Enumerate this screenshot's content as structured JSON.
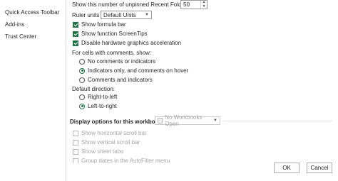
{
  "sidebar": {
    "items": [
      {
        "label": "Quick Access Toolbar"
      },
      {
        "label": "Add-ins"
      },
      {
        "label": "Trust Center"
      }
    ]
  },
  "display": {
    "recent_folders_label": "Show this number of unpinned Recent Folders:",
    "recent_folders_value": "50",
    "ruler_units_label": "Ruler units",
    "ruler_units_value": "Default Units",
    "show_formula_bar": "Show formula bar",
    "show_screentips": "Show function ScreenTips",
    "disable_hw_accel": "Disable hardware graphics acceleration",
    "comments_heading": "For cells with comments, show:",
    "comments_options": [
      "No comments or indicators",
      "Indicators only, and comments on hover",
      "Comments and indicators"
    ],
    "direction_heading": "Default direction:",
    "direction_options": [
      "Right-to-left",
      "Left-to-right"
    ]
  },
  "workbook": {
    "heading": "Display options for this workbook:",
    "select_value": "No Workbooks Open",
    "options": [
      "Show horizontal scroll bar",
      "Show vertical scroll bar",
      "Show sheet tabs",
      "Group dates in the AutoFilter menu"
    ]
  },
  "footer": {
    "ok_label": "OK",
    "cancel_label": "Cancel"
  },
  "colors": {
    "accent": "#217346",
    "disabled_text": "#a6a6a6"
  }
}
